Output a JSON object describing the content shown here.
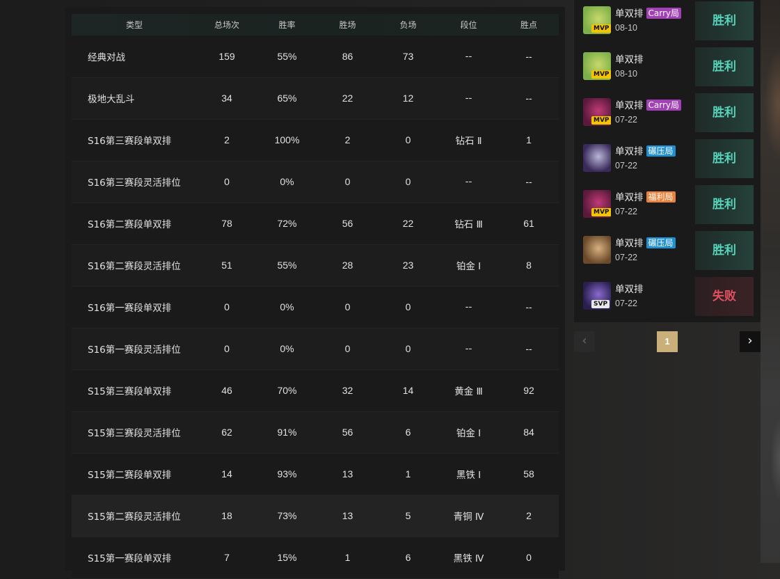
{
  "colors": {
    "win": "#55d4bb",
    "loss": "#e0505e",
    "tag_carry": "#a340b8",
    "tag_crush": "#1f8fd0",
    "tag_bonus": "#e9823c",
    "mvp": "#f5c400",
    "page_active": "#c9b07a"
  },
  "stats_table": {
    "headers": [
      "类型",
      "总场次",
      "胜率",
      "胜场",
      "负场",
      "段位",
      "胜点"
    ],
    "rows": [
      {
        "type": "经典对战",
        "total": "159",
        "rate": "55%",
        "wins": "86",
        "losses": "73",
        "tier": "--",
        "lp": "--"
      },
      {
        "type": "极地大乱斗",
        "total": "34",
        "rate": "65%",
        "wins": "22",
        "losses": "12",
        "tier": "--",
        "lp": "--"
      },
      {
        "type": "S16第三赛段单双排",
        "total": "2",
        "rate": "100%",
        "wins": "2",
        "losses": "0",
        "tier": "钻石 Ⅱ",
        "lp": "1"
      },
      {
        "type": "S16第三赛段灵活排位",
        "total": "0",
        "rate": "0%",
        "wins": "0",
        "losses": "0",
        "tier": "--",
        "lp": "--"
      },
      {
        "type": "S16第二赛段单双排",
        "total": "78",
        "rate": "72%",
        "wins": "56",
        "losses": "22",
        "tier": "钻石 Ⅲ",
        "lp": "61"
      },
      {
        "type": "S16第二赛段灵活排位",
        "total": "51",
        "rate": "55%",
        "wins": "28",
        "losses": "23",
        "tier": "铂金 Ⅰ",
        "lp": "8"
      },
      {
        "type": "S16第一赛段单双排",
        "total": "0",
        "rate": "0%",
        "wins": "0",
        "losses": "0",
        "tier": "--",
        "lp": "--"
      },
      {
        "type": "S16第一赛段灵活排位",
        "total": "0",
        "rate": "0%",
        "wins": "0",
        "losses": "0",
        "tier": "--",
        "lp": "--"
      },
      {
        "type": "S15第三赛段单双排",
        "total": "46",
        "rate": "70%",
        "wins": "32",
        "losses": "14",
        "tier": "黄金 Ⅲ",
        "lp": "92"
      },
      {
        "type": "S15第三赛段灵活排位",
        "total": "62",
        "rate": "91%",
        "wins": "56",
        "losses": "6",
        "tier": "铂金 Ⅰ",
        "lp": "84"
      },
      {
        "type": "S15第二赛段单双排",
        "total": "14",
        "rate": "93%",
        "wins": "13",
        "losses": "1",
        "tier": "黑铁 Ⅰ",
        "lp": "58"
      },
      {
        "type": "S15第二赛段灵活排位",
        "total": "18",
        "rate": "73%",
        "wins": "13",
        "losses": "5",
        "tier": "青铜 Ⅳ",
        "lp": "2"
      },
      {
        "type": "S15第一赛段单双排",
        "total": "7",
        "rate": "15%",
        "wins": "1",
        "losses": "6",
        "tier": "黑铁 Ⅳ",
        "lp": "0"
      }
    ]
  },
  "matches": [
    {
      "mode": "单双排",
      "tag": "Carry局",
      "tag_color": "tag_carry",
      "date": "08-10",
      "badge": "MVP",
      "result": "胜利",
      "win": true,
      "avatar_colors": [
        "#7db04a",
        "#c9d86a"
      ]
    },
    {
      "mode": "单双排",
      "tag": "",
      "tag_color": "",
      "date": "08-10",
      "badge": "MVP",
      "result": "胜利",
      "win": true,
      "avatar_colors": [
        "#7db04a",
        "#c9d86a"
      ]
    },
    {
      "mode": "单双排",
      "tag": "Carry局",
      "tag_color": "tag_carry",
      "date": "07-22",
      "badge": "MVP",
      "result": "胜利",
      "win": true,
      "avatar_colors": [
        "#5b1a3c",
        "#c03a78"
      ]
    },
    {
      "mode": "单双排",
      "tag": "碾压局",
      "tag_color": "tag_crush",
      "date": "07-22",
      "badge": "",
      "result": "胜利",
      "win": true,
      "avatar_colors": [
        "#3a2a5a",
        "#b9b6d8"
      ]
    },
    {
      "mode": "单双排",
      "tag": "福利局",
      "tag_color": "tag_bonus",
      "date": "07-22",
      "badge": "MVP",
      "result": "胜利",
      "win": true,
      "avatar_colors": [
        "#5b1a3c",
        "#c03a78"
      ]
    },
    {
      "mode": "单双排",
      "tag": "碾压局",
      "tag_color": "tag_crush",
      "date": "07-22",
      "badge": "",
      "result": "胜利",
      "win": true,
      "avatar_colors": [
        "#6a4a2a",
        "#d8b080"
      ]
    },
    {
      "mode": "单双排",
      "tag": "",
      "tag_color": "",
      "date": "07-22",
      "badge": "SVP",
      "result": "失败",
      "win": false,
      "avatar_colors": [
        "#2a2050",
        "#8a6ad0"
      ]
    }
  ],
  "pagination": {
    "prev_icon": "‹",
    "current_page": "1",
    "next_icon": "›"
  }
}
